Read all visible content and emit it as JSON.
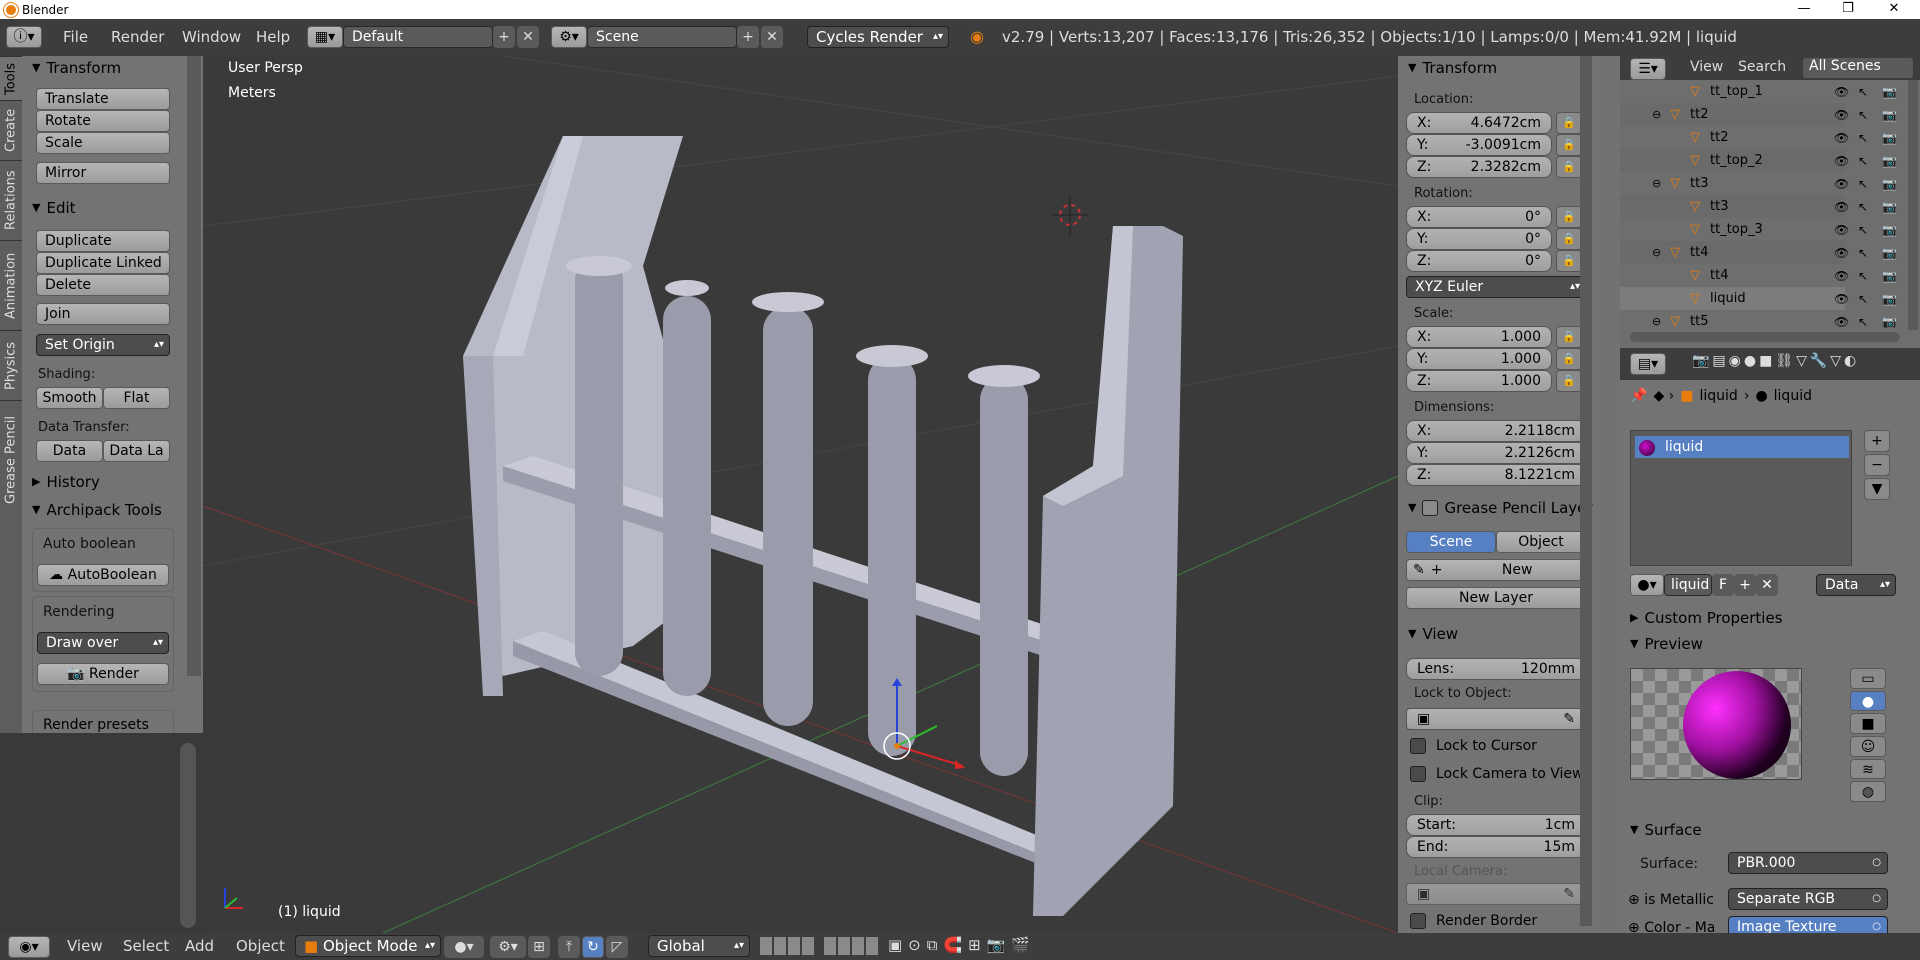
{
  "window": {
    "title": "Blender",
    "min": "—",
    "max": "❐",
    "close": "✕"
  },
  "topbar": {
    "menus": [
      "File",
      "Render",
      "Window",
      "Help"
    ],
    "layout": "Default",
    "scene": "Scene",
    "engine": "Cycles Render",
    "stats": "v2.79 | Verts:13,207 | Faces:13,176 | Tris:26,352 | Objects:1/10 | Lamps:0/0 | Mem:41.92M | liquid"
  },
  "toolshelf": {
    "tabs": [
      "Tools",
      "Create",
      "Relations",
      "Animation",
      "Physics",
      "Grease Pencil"
    ],
    "transform": {
      "title": "Transform",
      "buttons": [
        "Translate",
        "Rotate",
        "Scale",
        "Mirror"
      ]
    },
    "edit": {
      "title": "Edit",
      "buttons": [
        "Duplicate",
        "Duplicate Linked",
        "Delete",
        "Join"
      ],
      "set_origin": "Set Origin",
      "shading_label": "Shading:",
      "smooth": "Smooth",
      "flat": "Flat",
      "data_transfer_label": "Data Transfer:",
      "data": "Data",
      "data_la": "Data La"
    },
    "history": "History",
    "archipack": {
      "title": "Archipack Tools",
      "auto_boolean_label": "Auto boolean",
      "auto_boolean_btn": "AutoBoolean",
      "rendering_label": "Rendering",
      "draw_over": "Draw over",
      "render": "Render",
      "render_presets": "Render presets ..."
    }
  },
  "viewport": {
    "view_name": "User Persp",
    "units": "Meters",
    "object_label": "(1) liquid"
  },
  "properties_n": {
    "transform_title": "Transform",
    "location_label": "Location:",
    "loc_x": "4.6472cm",
    "loc_y": "-3.0091cm",
    "loc_z": "2.3282cm",
    "rotation_label": "Rotation:",
    "rot_x": "0°",
    "rot_y": "0°",
    "rot_z": "0°",
    "rot_mode": "XYZ Euler",
    "scale_label": "Scale:",
    "scale_x": "1.000",
    "scale_y": "1.000",
    "scale_z": "1.000",
    "dimensions_label": "Dimensions:",
    "dim_x": "2.2118cm",
    "dim_y": "2.2126cm",
    "dim_z": "8.1221cm",
    "gp_title": "Grease Pencil Layer",
    "gp_scene": "Scene",
    "gp_object": "Object",
    "gp_new": "New",
    "gp_new_layer": "New Layer",
    "view_title": "View",
    "lens": "Lens:",
    "lens_val": "120mm",
    "lock_obj": "Lock to Object:",
    "lock_cursor": "Lock to Cursor",
    "lock_camera": "Lock Camera to View",
    "clip_label": "Clip:",
    "clip_start": "Start:",
    "clip_start_val": "1cm",
    "clip_end": "End:",
    "clip_end_val": "15m",
    "local_camera": "Local Camera:",
    "render_border": "Render Border",
    "axis_x": "X:",
    "axis_y": "Y:",
    "axis_z": "Z:"
  },
  "outliner": {
    "view": "View",
    "search": "Search",
    "all_scenes": "All Scenes",
    "rows": [
      {
        "label": "tt_top_1",
        "indent": 3
      },
      {
        "label": "tt2",
        "indent": 2
      },
      {
        "label": "tt2",
        "indent": 3
      },
      {
        "label": "tt_top_2",
        "indent": 3
      },
      {
        "label": "tt3",
        "indent": 2
      },
      {
        "label": "tt3",
        "indent": 3
      },
      {
        "label": "tt_top_3",
        "indent": 3
      },
      {
        "label": "tt4",
        "indent": 2
      },
      {
        "label": "tt4",
        "indent": 3
      },
      {
        "label": "liquid",
        "indent": 3
      },
      {
        "label": "tt5",
        "indent": 2
      }
    ]
  },
  "material": {
    "crumb_obj": "liquid",
    "crumb_mat": "liquid",
    "slot": "liquid",
    "mat_name": "liquid",
    "f": "F",
    "data": "Data",
    "custom_props": "Custom Properties",
    "preview": "Preview",
    "surface_title": "Surface",
    "surface_label": "Surface:",
    "surface_val": "PBR.000",
    "metallic_label": "is Metallic",
    "metallic_val": "Separate RGB",
    "color_label": "Color - Ma",
    "color_val": "Image Texture"
  },
  "bottombar": {
    "menus": [
      "View",
      "Select",
      "Add",
      "Object"
    ],
    "mode": "Object Mode",
    "orientation": "Global"
  }
}
